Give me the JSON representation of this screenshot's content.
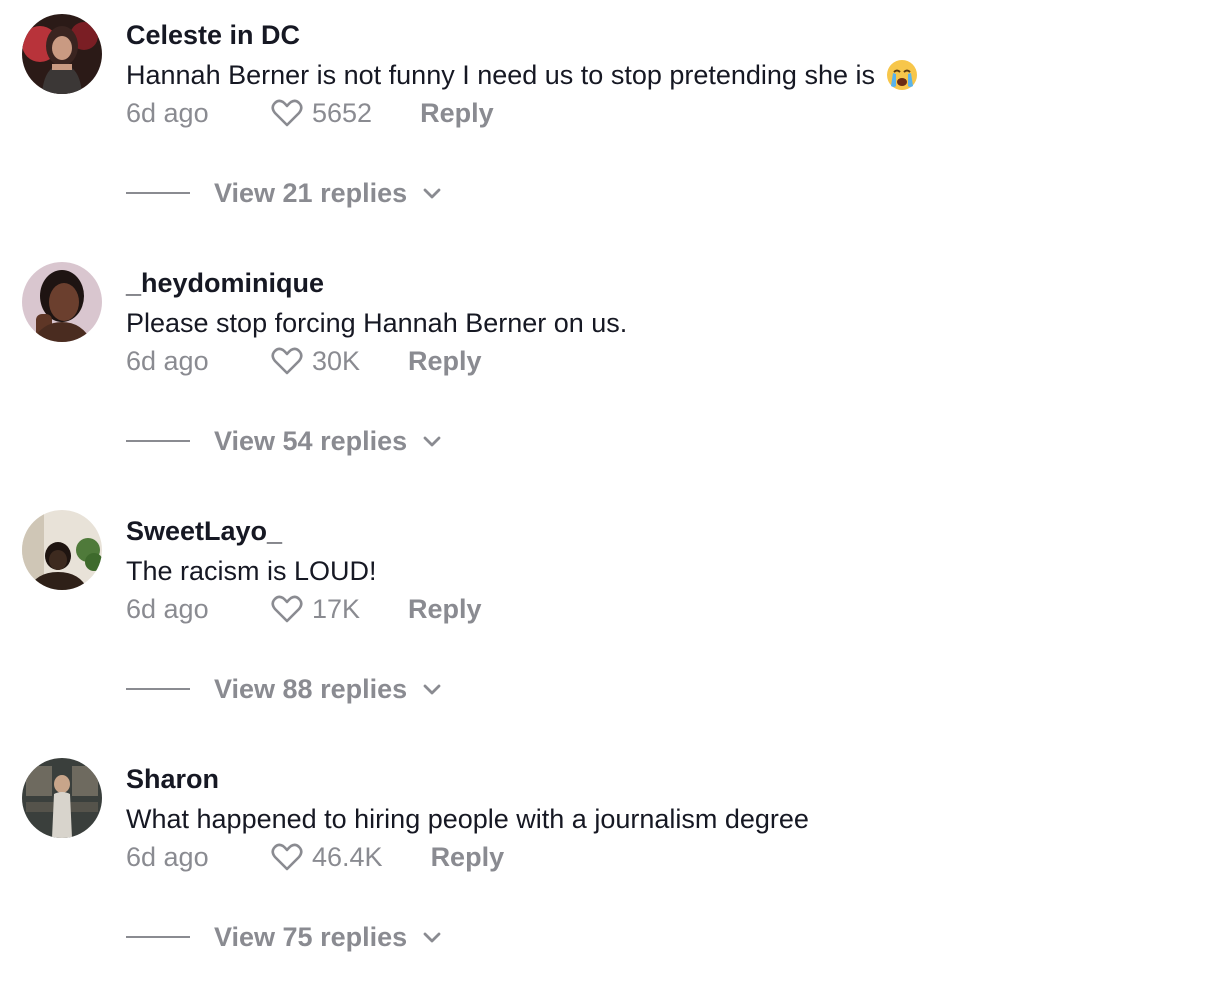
{
  "comments": [
    {
      "username": "Celeste in DC",
      "text": "Hannah Berner is not funny I need us to stop pretending she is",
      "emoji": "loudly-crying-face-emoji",
      "time": "6d ago",
      "likes": "5652",
      "reply_label": "Reply",
      "view_replies": "View 21 replies",
      "avatar_colors": [
        "#2b1a17",
        "#b8333a",
        "#3a2c2a"
      ]
    },
    {
      "username": "_heydominique",
      "text": "Please stop forcing Hannah Berner on us.",
      "time": "6d ago",
      "likes": "30K",
      "reply_label": "Reply",
      "view_replies": "View 54 replies",
      "avatar_colors": [
        "#d9c6cf",
        "#6b3f2e",
        "#1e1412"
      ]
    },
    {
      "username": "SweetLayo_",
      "text": "The racism is LOUD!",
      "time": "6d ago",
      "likes": "17K",
      "reply_label": "Reply",
      "view_replies": "View 88 replies",
      "avatar_colors": [
        "#e8e2d8",
        "#3d2a1f",
        "#4f7a3a"
      ]
    },
    {
      "username": "Sharon",
      "text": "What happened to hiring people with a journalism degree",
      "time": "6d ago",
      "likes": "46.4K",
      "reply_label": "Reply",
      "view_replies": "View 75 replies",
      "avatar_colors": [
        "#3a3f3c",
        "#d8d4cc",
        "#6e6a5f"
      ]
    }
  ],
  "colors": {
    "primary_text": "#161823",
    "secondary_text": "#8a8b91"
  }
}
